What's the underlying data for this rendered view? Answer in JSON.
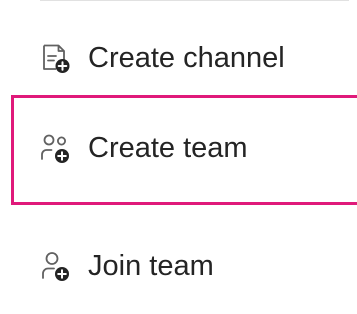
{
  "menu": {
    "items": [
      {
        "label": "Create channel",
        "icon": "create-channel-icon"
      },
      {
        "label": "Create team",
        "icon": "create-team-icon"
      },
      {
        "label": "Join team",
        "icon": "join-team-icon"
      }
    ],
    "highlighted_item": "Create team"
  },
  "colors": {
    "text": "#242424",
    "highlight": "#e0197a",
    "divider": "#e1e1e1",
    "icon_stroke": "#616161",
    "icon_badge": "#242424"
  }
}
